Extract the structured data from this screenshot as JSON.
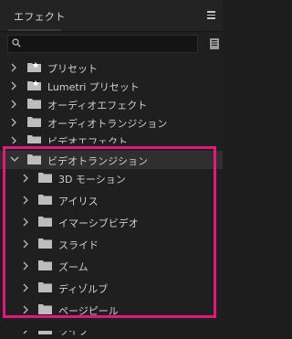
{
  "panel": {
    "title": "エフェクト",
    "menu_icon": "hamburger-menu-icon"
  },
  "search": {
    "value": "",
    "placeholder": ""
  },
  "tree": {
    "items": [
      {
        "label": "プリセット",
        "icon": "preset-folder-icon",
        "expanded": false,
        "depth": 0
      },
      {
        "label": "Lumetri プリセット",
        "icon": "preset-folder-icon",
        "expanded": false,
        "depth": 0
      },
      {
        "label": "オーディオエフェクト",
        "icon": "folder-icon",
        "expanded": false,
        "depth": 0
      },
      {
        "label": "オーディオトランジション",
        "icon": "folder-icon",
        "expanded": false,
        "depth": 0
      },
      {
        "label": "ビデオエフェクト",
        "icon": "folder-icon",
        "expanded": false,
        "depth": 0
      },
      {
        "label": "ビデオトランジション",
        "icon": "folder-icon",
        "expanded": true,
        "depth": 0
      },
      {
        "label": "3D モーション",
        "icon": "folder-icon",
        "expanded": false,
        "depth": 1
      },
      {
        "label": "アイリス",
        "icon": "folder-icon",
        "expanded": false,
        "depth": 1
      },
      {
        "label": "イマーシブビデオ",
        "icon": "folder-icon",
        "expanded": false,
        "depth": 1
      },
      {
        "label": "スライド",
        "icon": "folder-icon",
        "expanded": false,
        "depth": 1
      },
      {
        "label": "ズーム",
        "icon": "folder-icon",
        "expanded": false,
        "depth": 1
      },
      {
        "label": "ディゾルブ",
        "icon": "folder-icon",
        "expanded": false,
        "depth": 1
      },
      {
        "label": "ページピール",
        "icon": "folder-icon",
        "expanded": false,
        "depth": 1
      },
      {
        "label": "ワイプ",
        "icon": "folder-icon",
        "expanded": false,
        "depth": 1
      }
    ]
  },
  "colors": {
    "highlight": "#e0197d",
    "background": "#1f1f1f",
    "text": "#cfcfcf"
  }
}
